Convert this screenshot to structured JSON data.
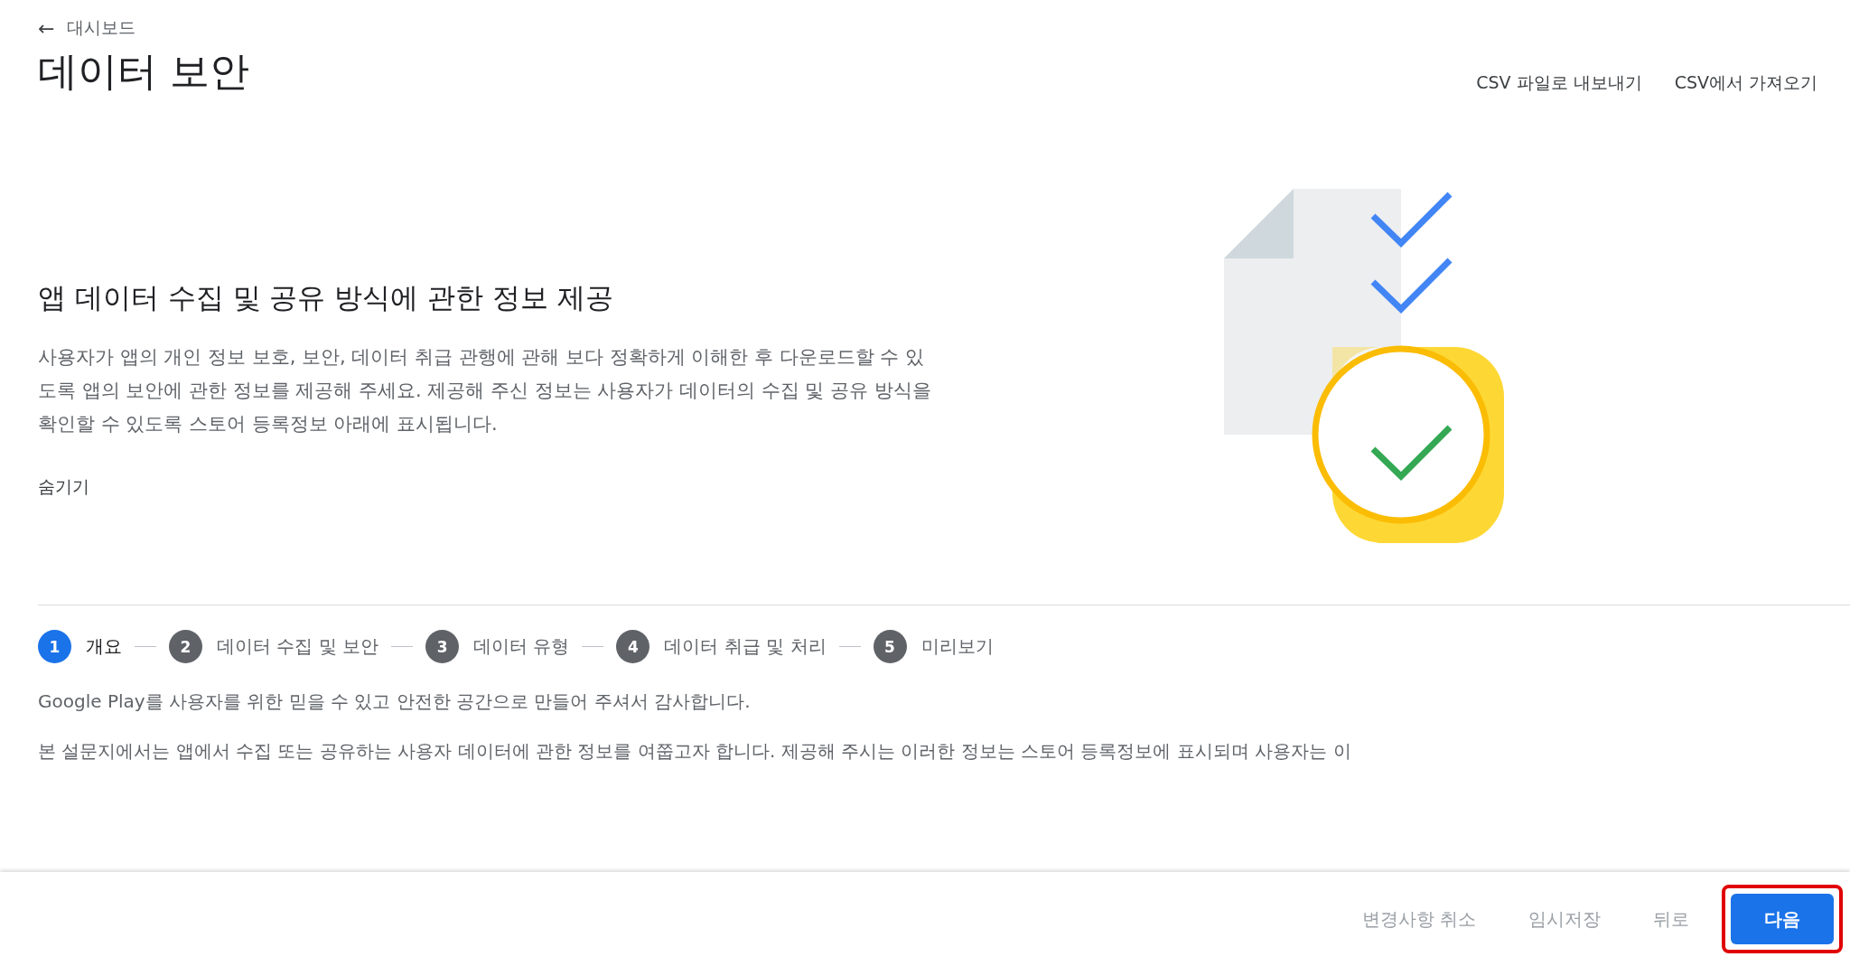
{
  "back_link": {
    "icon": "←",
    "label": "대시보드"
  },
  "page_title": "데이터 보안",
  "header_actions": [
    "CSV 파일로 내보내기",
    "CSV에서 가져오기"
  ],
  "intro": {
    "heading": "앱 데이터 수집 및 공유 방식에 관한 정보 제공",
    "body": "사용자가 앱의 개인 정보 보호, 보안, 데이터 취급 관행에 관해 보다 정확하게 이해한 후 다운로드할 수 있도록 앱의 보안에 관한 정보를 제공해 주세요. 제공해 주신 정보는 사용자가 데이터의 수집 및 공유 방식을 확인할 수 있도록 스토어 등록정보 아래에 표시됩니다.",
    "toggle": "숨기기"
  },
  "steps": [
    {
      "number": "1",
      "label": "개요",
      "selected": true
    },
    {
      "number": "2",
      "label": "데이터 수집 및 보안",
      "selected": false
    },
    {
      "number": "3",
      "label": "데이터 유형",
      "selected": false
    },
    {
      "number": "4",
      "label": "데이터 취급 및 처리",
      "selected": false
    },
    {
      "number": "5",
      "label": "미리보기",
      "selected": false
    }
  ],
  "content": [
    "Google Play를 사용자를 위한 믿을 수 있고 안전한 공간으로 만들어 주셔서 감사합니다.",
    "본 설문지에서는 앱에서 수집 또는 공유하는 사용자 데이터에 관한 정보를 여쭙고자 합니다. 제공해 주시는 이러한 정보는 스토어 등록정보에 표시되며 사용자는 이"
  ],
  "footer": {
    "buttons": [
      {
        "kind": "text",
        "label": "변경사항 취소",
        "disabled": true
      },
      {
        "kind": "text",
        "label": "임시저장",
        "disabled": true
      },
      {
        "kind": "text",
        "label": "뒤로",
        "disabled": true
      },
      {
        "kind": "primary",
        "label": "다음",
        "disabled": false,
        "highlighted": true
      }
    ]
  }
}
